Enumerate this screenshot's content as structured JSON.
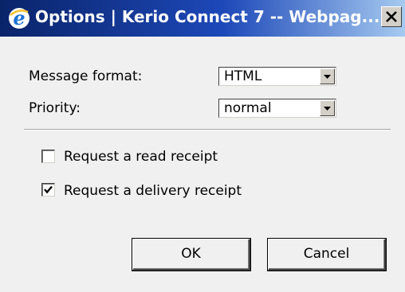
{
  "window": {
    "title": "Options | Kerio Connect 7 -- Webpag...",
    "icon": "internet-explorer-icon",
    "close_icon": "close-icon"
  },
  "form": {
    "message_format": {
      "label": "Message format:",
      "value": "HTML"
    },
    "priority": {
      "label": "Priority:",
      "value": "normal"
    },
    "read_receipt": {
      "label": "Request a read receipt",
      "checked": false
    },
    "delivery_receipt": {
      "label": "Request a delivery receipt",
      "checked": true
    }
  },
  "buttons": {
    "ok": "OK",
    "cancel": "Cancel"
  },
  "colors": {
    "titlebar_start": "#0a246a",
    "titlebar_end": "#a6caf0",
    "dialog_bg": "#f0f0f0"
  }
}
